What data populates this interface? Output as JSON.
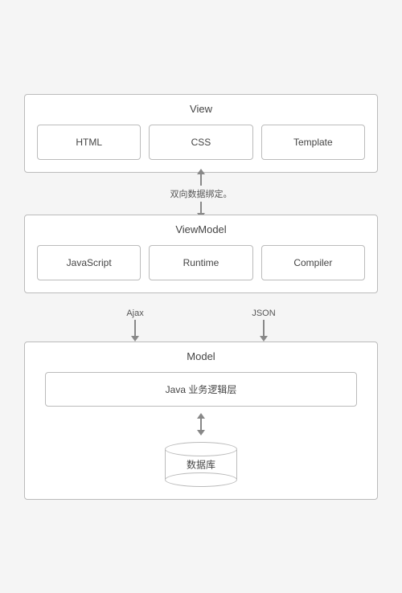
{
  "view": {
    "title": "View",
    "boxes": [
      {
        "label": "HTML"
      },
      {
        "label": "CSS"
      },
      {
        "label": "Template"
      }
    ]
  },
  "connector_bidir": {
    "label": "双向数据绑定。"
  },
  "viewmodel": {
    "title": "ViewModel",
    "boxes": [
      {
        "label": "JavaScript"
      },
      {
        "label": "Runtime"
      },
      {
        "label": "Compiler"
      }
    ]
  },
  "connector_split": {
    "left_label": "Ajax",
    "right_label": "JSON"
  },
  "model": {
    "title": "Model",
    "java_label": "Java 业务逻辑层",
    "db_label": "数据库"
  }
}
